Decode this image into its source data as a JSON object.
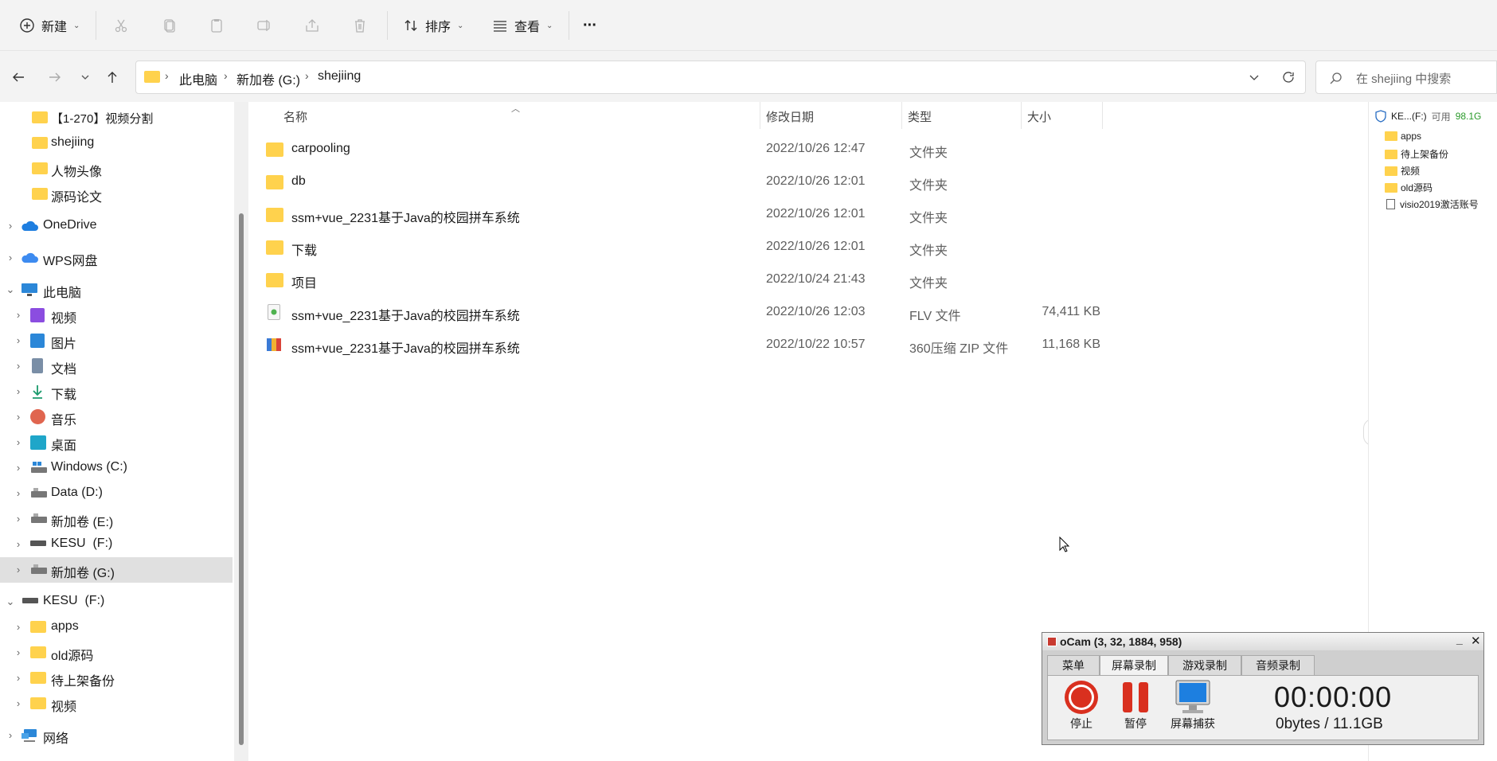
{
  "toolbar": {
    "new_label": "新建",
    "sort_label": "排序",
    "view_label": "查看",
    "more_label": "···"
  },
  "address": {
    "crumbs": [
      "此电脑",
      "新加卷 (G:)",
      "shejiing"
    ],
    "search_placeholder": "在 shejiing 中搜索"
  },
  "sidebar": {
    "items": [
      {
        "label": "【1-270】视频分割"
      },
      {
        "label": "shejiing"
      },
      {
        "label": "人物头像"
      },
      {
        "label": "源码论文"
      },
      {
        "label": "OneDrive"
      },
      {
        "label": "WPS网盘"
      },
      {
        "label": "此电脑"
      },
      {
        "label": "视频"
      },
      {
        "label": "图片"
      },
      {
        "label": "文档"
      },
      {
        "label": "下载"
      },
      {
        "label": "音乐"
      },
      {
        "label": "桌面"
      },
      {
        "label": "Windows (C:)"
      },
      {
        "label": "Data (D:)"
      },
      {
        "label": "新加卷 (E:)"
      },
      {
        "label": "KESU  (F:)"
      },
      {
        "label": "新加卷 (G:)"
      },
      {
        "label": "KESU  (F:)"
      },
      {
        "label": "apps"
      },
      {
        "label": "old源码"
      },
      {
        "label": "待上架备份"
      },
      {
        "label": "视频"
      },
      {
        "label": "网络"
      }
    ]
  },
  "files": {
    "headers": {
      "name": "名称",
      "date": "修改日期",
      "type": "类型",
      "size": "大小"
    },
    "rows": [
      {
        "name": "carpooling",
        "date": "2022/10/26 12:47",
        "type": "文件夹",
        "size": "",
        "icon": "folder-icon"
      },
      {
        "name": "db",
        "date": "2022/10/26 12:01",
        "type": "文件夹",
        "size": "",
        "icon": "folder-icon"
      },
      {
        "name": "ssm+vue_2231基于Java的校园拼车系统",
        "date": "2022/10/26 12:01",
        "type": "文件夹",
        "size": "",
        "icon": "folder-icon"
      },
      {
        "name": "下载",
        "date": "2022/10/26 12:01",
        "type": "文件夹",
        "size": "",
        "icon": "folder-icon"
      },
      {
        "name": "项目",
        "date": "2022/10/24 21:43",
        "type": "文件夹",
        "size": "",
        "icon": "folder-icon"
      },
      {
        "name": "ssm+vue_2231基于Java的校园拼车系统",
        "date": "2022/10/26 12:03",
        "type": "FLV 文件",
        "size": "74,411 KB",
        "icon": "flv-file-icon"
      },
      {
        "name": "ssm+vue_2231基于Java的校园拼车系统",
        "date": "2022/10/22 10:57",
        "type": "360压缩 ZIP 文件",
        "size": "11,168 KB",
        "icon": "zip-file-icon"
      }
    ]
  },
  "preview": {
    "drive_label": "KE...(F:)",
    "free_label": "可用",
    "free_value": "98.1G",
    "items": [
      "apps",
      "待上架备份",
      "视频",
      "old源码",
      "visio2019激活账号"
    ]
  },
  "ocam": {
    "title": "oCam (3, 32, 1884, 958)",
    "tabs": [
      "菜单",
      "屏幕录制",
      "游戏录制",
      "音频录制"
    ],
    "stop_label": "停止",
    "pause_label": "暂停",
    "capture_label": "屏幕捕获",
    "time": "00:00:00",
    "size": "0bytes / 11.1GB"
  }
}
